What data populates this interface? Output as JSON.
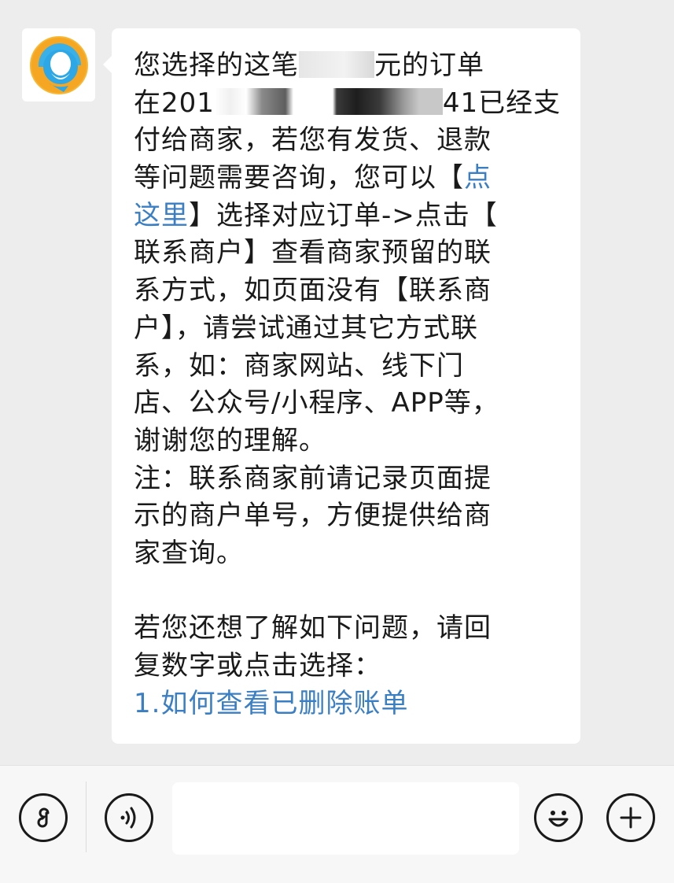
{
  "chat": {
    "message": {
      "lines": [
        [
          "您选择的这笔",
          "",
          "元的订单"
        ],
        [
          "在201",
          "",
          "41已经支"
        ],
        [
          "付给商家，若您有发货、退款"
        ],
        [
          "等问题需要咨询，您可以【",
          "点"
        ],
        [
          "这里",
          "】选择对应订单->点击【"
        ],
        [
          "联系商户】查看商家预留的联"
        ],
        [
          "系方式，如页面没有【联系商"
        ],
        [
          "户】，请尝试通过其它方式联"
        ],
        [
          "系，如：商家网站、线下门"
        ],
        [
          "店、公众号/小程序、APP等，"
        ],
        [
          "谢谢您的理解。"
        ],
        [
          "注：联系商家前请记录页面提"
        ],
        [
          "示的商户单号，方便提供给商"
        ],
        [
          "家查询。"
        ],
        [
          ""
        ],
        [
          "若您还想了解如下问题，请回"
        ],
        [
          "复数字或点击选择："
        ],
        [
          "1.如何查看已删除账单"
        ]
      ]
    },
    "colors": {
      "link": "#3a7ec4",
      "text": "#1a1a1a",
      "background": "#ededed",
      "bubble": "#ffffff"
    }
  },
  "toolbar": {
    "mini_program_icon": "mini-program-icon",
    "voice_icon": "voice-icon",
    "emoji_icon": "emoji-icon",
    "plus_icon": "plus-icon",
    "input_value": ""
  }
}
